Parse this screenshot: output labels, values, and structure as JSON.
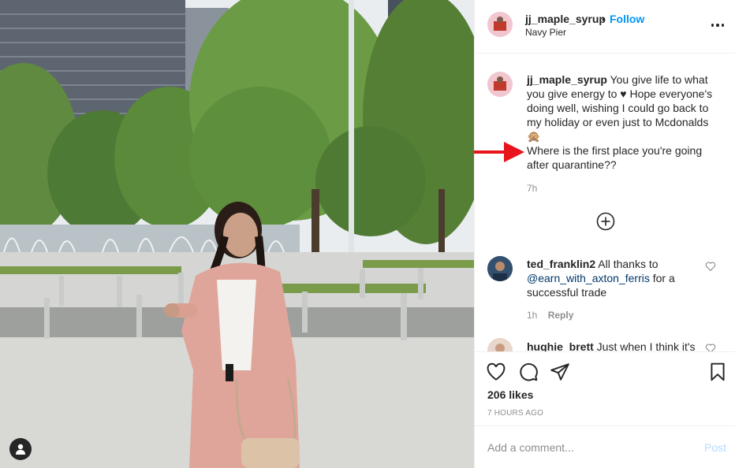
{
  "post": {
    "username": "jj_maple_syrup",
    "separator": "•",
    "follow_label": "Follow",
    "location": "Navy Pier",
    "more_icon": "more-horizontal-icon"
  },
  "caption": {
    "username": "jj_maple_syrup",
    "line1": "You give life to what you give energy to ♥ Hope everyone's doing well, wishing I could go back to my holiday or even just to Mcdonalds",
    "emoji": "🙊",
    "line2": "Where is the first place you're going after quarantine??",
    "time": "7h"
  },
  "load_more_icon": "plus-circle-icon",
  "comments": [
    {
      "username": "ted_franklin2",
      "text_before": "All thanks to",
      "mention": "@earn_with_axton_ferris",
      "text_after": "for a successful trade",
      "time": "1h",
      "reply_label": "Reply"
    },
    {
      "username": "hughie_brett",
      "text": "Just when I think it's"
    }
  ],
  "actions": {
    "likes": "206 likes",
    "posted": "7 HOURS AGO"
  },
  "add_comment": {
    "placeholder": "Add a comment...",
    "post_label": "Post"
  },
  "colors": {
    "accent": "#0095f6",
    "post_disabled": "#b3dbff",
    "annotation_arrow": "#e8141b"
  }
}
